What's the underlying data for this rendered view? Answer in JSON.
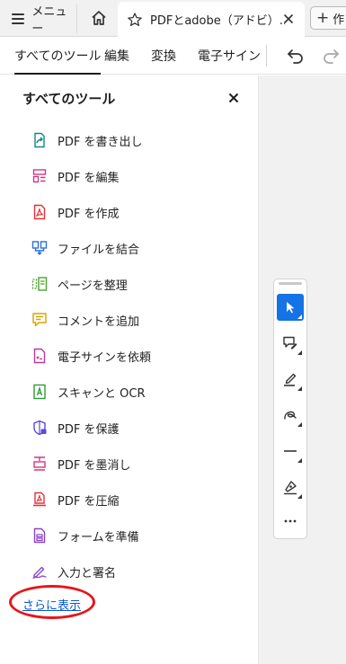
{
  "tabbar": {
    "menu_label": "メニュー",
    "doc_tab_title": "PDFとadobe（アドビ）...",
    "new_tab_label": "作"
  },
  "toolbar": {
    "tabs": [
      {
        "label": "すべてのツール",
        "active": true
      },
      {
        "label": "編集",
        "active": false
      },
      {
        "label": "変換",
        "active": false
      },
      {
        "label": "電子サイン",
        "active": false
      }
    ]
  },
  "panel": {
    "title": "すべてのツール",
    "tools": [
      {
        "label": "PDF を書き出し",
        "icon": "export-pdf-icon",
        "color": "#0f8a84"
      },
      {
        "label": "PDF を編集",
        "icon": "edit-pdf-icon",
        "color": "#d6367f"
      },
      {
        "label": "PDF を作成",
        "icon": "create-pdf-icon",
        "color": "#e0333a"
      },
      {
        "label": "ファイルを結合",
        "icon": "combine-files-icon",
        "color": "#2e6fd6"
      },
      {
        "label": "ページを整理",
        "icon": "organize-pages-icon",
        "color": "#49a62a"
      },
      {
        "label": "コメントを追加",
        "icon": "comment-icon",
        "color": "#d9a300"
      },
      {
        "label": "電子サインを依頼",
        "icon": "request-signature-icon",
        "color": "#c2369a"
      },
      {
        "label": "スキャンと OCR",
        "icon": "scan-ocr-icon",
        "color": "#2f9a3c"
      },
      {
        "label": "PDF を保護",
        "icon": "protect-pdf-icon",
        "color": "#5a4bd6"
      },
      {
        "label": "PDF を墨消し",
        "icon": "redact-pdf-icon",
        "color": "#d6367f"
      },
      {
        "label": "PDF を圧縮",
        "icon": "compress-pdf-icon",
        "color": "#e0333a"
      },
      {
        "label": "フォームを準備",
        "icon": "prepare-form-icon",
        "color": "#8a44c7"
      },
      {
        "label": "入力と署名",
        "icon": "fill-sign-icon",
        "color": "#8a44c7"
      }
    ],
    "more_link": "さらに表示"
  },
  "quick_tools": [
    {
      "name": "select-tool",
      "icon": "cursor-icon",
      "active": true
    },
    {
      "name": "comment-tool",
      "icon": "comment-pen-icon",
      "active": false
    },
    {
      "name": "highlight-tool",
      "icon": "highlighter-icon",
      "active": false
    },
    {
      "name": "draw-tool",
      "icon": "freehand-icon",
      "active": false
    },
    {
      "name": "line-tool",
      "icon": "line-icon",
      "active": false
    },
    {
      "name": "sign-tool",
      "icon": "pen-nib-icon",
      "active": false
    },
    {
      "name": "more-tools",
      "icon": "ellipsis-icon",
      "active": false
    }
  ],
  "colors": {
    "accent": "#1473e6",
    "highlight_ring": "#e8141c",
    "link": "#0b57d0"
  }
}
